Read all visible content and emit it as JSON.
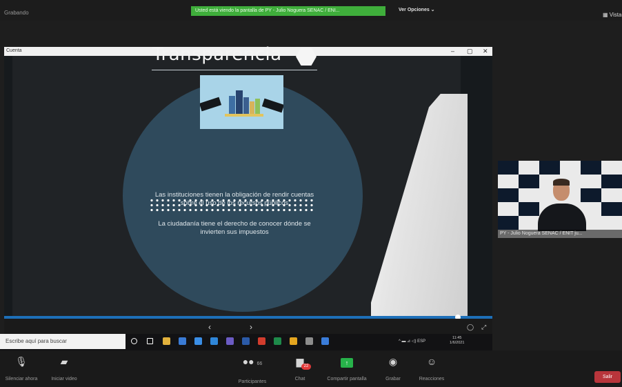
{
  "topbar": {
    "recording_label": "Grabando",
    "share_banner": "Usted está viendo la pantalla de PY - Julio Noguera SENAC / ENI...",
    "view_options": "Ver Opciones ⌄",
    "view_right": "▦ Vista"
  },
  "presentation_window": {
    "title": "Cuenta",
    "minimize": "–",
    "maximize": "▢",
    "close": "✕"
  },
  "slide": {
    "title": "Transparencia",
    "paragraph1": "Las instituciones tienen la obligación de rendir cuentas sobre el uso de los recursos públicos",
    "paragraph2": "La ciudadanía tiene el derecho de conocer dónde se invierten sus impuestos"
  },
  "slideshow_controls": {
    "prev": "‹",
    "next": "›",
    "ctrl1": "◯",
    "ctrl2": "⤢"
  },
  "taskbar": {
    "search_placeholder": "Escribe aquí para buscar",
    "tray": "^ ▬ ⊿ ◁) ESP",
    "time": "11:45",
    "date": "1/6/2021",
    "icons": [
      "start-icon",
      "task-view-icon",
      "file-explorer-icon",
      "store-icon",
      "mail-icon",
      "edge-icon",
      "teams-icon",
      "word-icon",
      "pdf-icon",
      "excel-icon",
      "chrome-icon",
      "app-icon",
      "zoom-icon"
    ],
    "icon_colors": [
      "#ffffff",
      "#ffffff",
      "#e2b13c",
      "#3a7bd5",
      "#3a8ee6",
      "#2f86d9",
      "#6b5bc4",
      "#2b5aa8",
      "#d23c2d",
      "#1e8a4a",
      "#e4a51f",
      "#8c8c8c",
      "#3a7cd9"
    ]
  },
  "webcam": {
    "label": "PY - Julio Noguera SENAC / ENIT ju..."
  },
  "bottom_bar": {
    "mute_label": "Silenciar ahora",
    "video_label": "Iniciar video",
    "participants_label": "Participantes",
    "participants_count": "66",
    "chat_label": "Chat",
    "chat_badge": "22",
    "share_label": "Compartir pantalla",
    "record_label": "Grabar",
    "reactions_label": "Reacciones",
    "leave_label": "Salir"
  },
  "colors": {
    "share_banner": "#3fae3b",
    "slide_circle": "#2f4a5c",
    "progress": "#1d6fb8",
    "leave": "#b8353b"
  },
  "slideshow_progress": 0.93
}
